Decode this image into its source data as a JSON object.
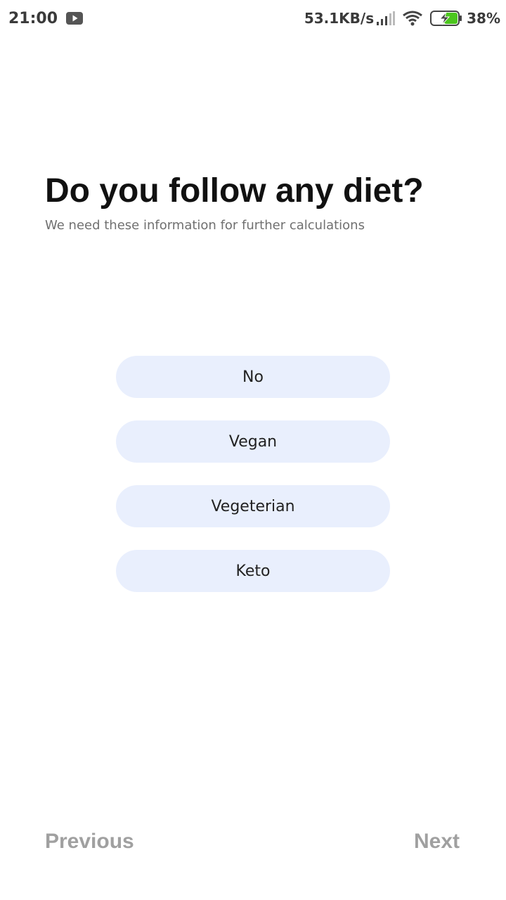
{
  "status_bar": {
    "time": "21:00",
    "net_speed": "53.1KB/s",
    "battery": "38%",
    "icons": [
      "youtube-notification-icon",
      "signal-icon",
      "wifi-icon",
      "battery-charging-icon"
    ],
    "battery_accent": "#4cc61e"
  },
  "question": {
    "title": "Do you follow any diet?",
    "subtitle": "We need these information for further calculations"
  },
  "options": [
    {
      "label": "No"
    },
    {
      "label": "Vegan"
    },
    {
      "label": "Vegeterian"
    },
    {
      "label": "Keto"
    }
  ],
  "navigation": {
    "previous_label": "Previous",
    "next_label": "Next"
  },
  "colors": {
    "option_background": "#e9effd",
    "title_text": "#111111",
    "nav_text": "#a0a0a0"
  }
}
